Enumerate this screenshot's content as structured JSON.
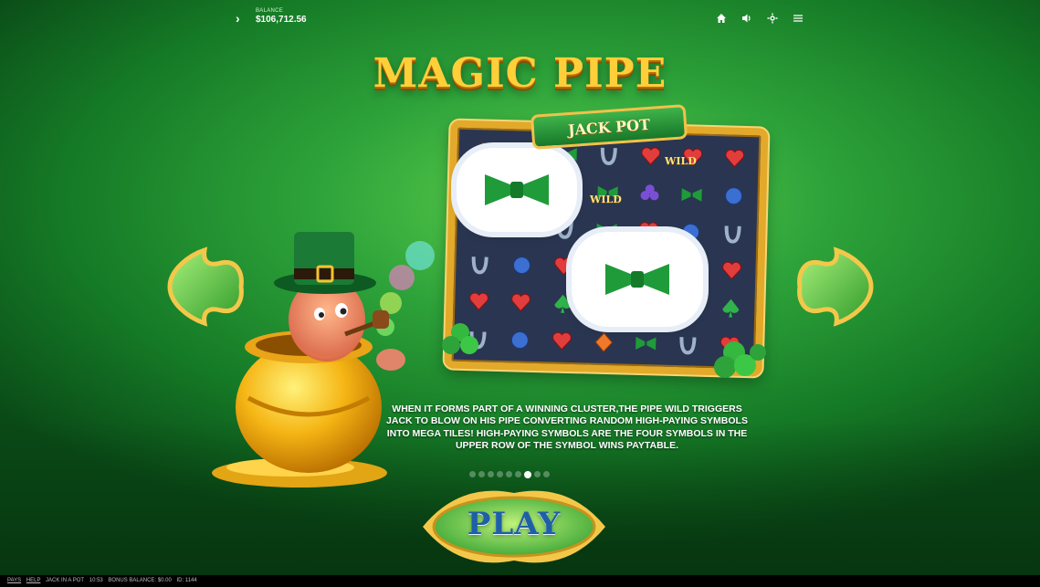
{
  "topbar": {
    "balance_label": "BALANCE",
    "balance_value": "$106,712.56",
    "icons": [
      "chevron-right-icon",
      "home-icon",
      "sound-icon",
      "settings-icon",
      "menu-icon"
    ]
  },
  "title": "MAGIC PIPE",
  "board": {
    "logo_text": "JACK POT",
    "wild_label": "WILD"
  },
  "description": "WHEN IT FORMS PART OF A WINNING CLUSTER,THE PIPE WILD TRIGGERS JACK TO BLOW ON HIS PIPE CONVERTING RANDOM HIGH-PAYING SYMBOLS INTO MEGA TILES! HIGH-PAYING SYMBOLS ARE THE FOUR SYMBOLS IN THE UPPER ROW OF THE SYMBOL WINS PAYTABLE.",
  "pagination": {
    "total": 9,
    "active_index": 6
  },
  "play_label": "PLAY",
  "footer": {
    "pays": "PAYS",
    "help": "HELP",
    "game": "JACK IN A POT",
    "time": "10:53",
    "bonus_balance": "BONUS BALANCE: $0.00",
    "id": "ID: 1144"
  },
  "colors": {
    "title_gold": "#ffcf3a",
    "background_green": "#2ea33a",
    "play_blue": "#1e5fa8"
  }
}
